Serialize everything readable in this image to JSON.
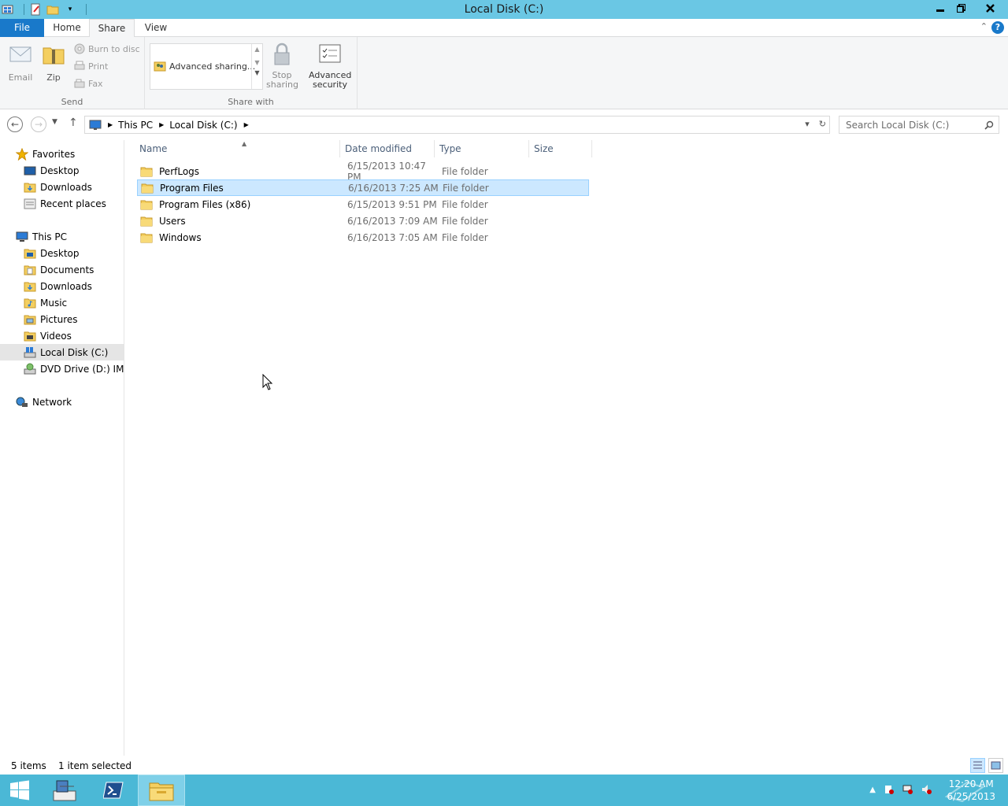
{
  "window": {
    "title": "Local Disk (C:)"
  },
  "ribbon_tabs": {
    "file": "File",
    "home": "Home",
    "share": "Share",
    "view": "View"
  },
  "ribbon": {
    "send_group": {
      "label": "Send",
      "email": "Email",
      "zip": "Zip",
      "burn": "Burn to disc",
      "print": "Print",
      "fax": "Fax"
    },
    "share_with_group": {
      "label": "Share with",
      "advanced_sharing": "Advanced sharing...",
      "stop_sharing_line1": "Stop",
      "stop_sharing_line2": "sharing"
    },
    "advanced_security_line1": "Advanced",
    "advanced_security_line2": "security"
  },
  "address": {
    "crumbs": [
      "This PC",
      "Local Disk (C:)"
    ],
    "search_placeholder": "Search Local Disk (C:)"
  },
  "nav_pane": {
    "favorites": "Favorites",
    "favorites_items": [
      "Desktop",
      "Downloads",
      "Recent places"
    ],
    "this_pc": "This PC",
    "this_pc_items": [
      "Desktop",
      "Documents",
      "Downloads",
      "Music",
      "Pictures",
      "Videos",
      "Local Disk (C:)",
      "DVD Drive (D:) IMP_S"
    ],
    "network": "Network",
    "selected": "Local Disk (C:)"
  },
  "columns": {
    "name": "Name",
    "date": "Date modified",
    "type": "Type",
    "size": "Size"
  },
  "files": [
    {
      "name": "PerfLogs",
      "date": "6/15/2013 10:47 PM",
      "type": "File folder",
      "selected": false
    },
    {
      "name": "Program Files",
      "date": "6/16/2013 7:25 AM",
      "type": "File folder",
      "selected": true
    },
    {
      "name": "Program Files (x86)",
      "date": "6/15/2013 9:51 PM",
      "type": "File folder",
      "selected": false
    },
    {
      "name": "Users",
      "date": "6/16/2013 7:09 AM",
      "type": "File folder",
      "selected": false
    },
    {
      "name": "Windows",
      "date": "6/16/2013 7:05 AM",
      "type": "File folder",
      "selected": false
    }
  ],
  "status": {
    "count": "5 items",
    "selection": "1 item selected"
  },
  "taskbar": {
    "time": "12:20 AM",
    "date": "6/25/2013"
  },
  "icons": {
    "folder": "folder-icon",
    "drive": "local-disk-icon",
    "star": "star-icon",
    "network": "network-icon"
  },
  "colors": {
    "titlebar": "#6ac7e4",
    "file_tab": "#1979ca",
    "selection": "#cce8ff",
    "taskbar": "#4bb8d6"
  }
}
